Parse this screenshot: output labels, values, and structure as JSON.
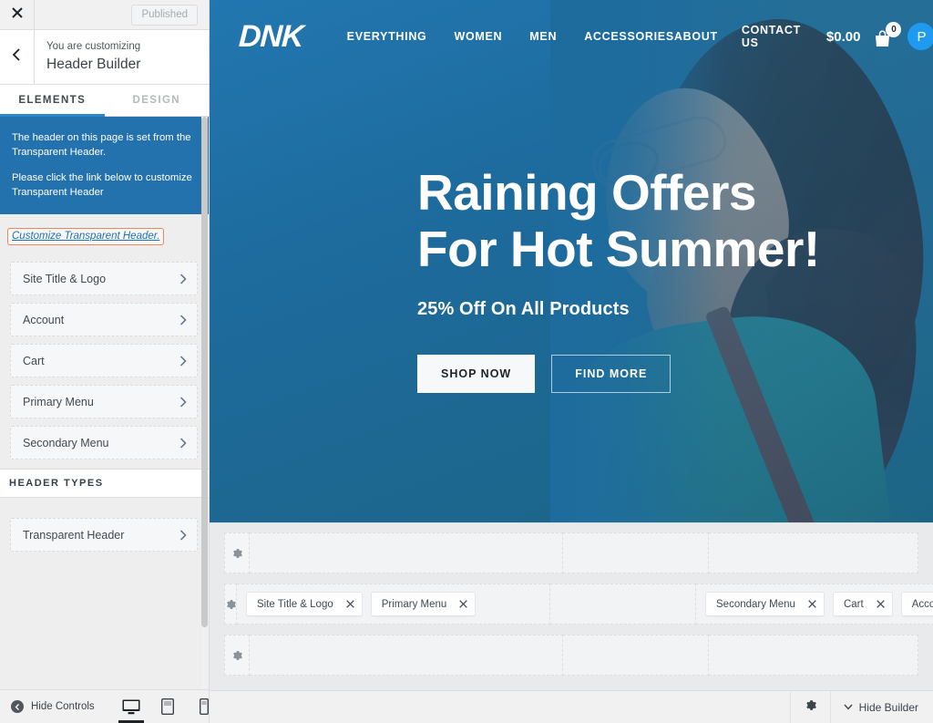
{
  "sidebar": {
    "close_icon": "close-icon",
    "published_label": "Published",
    "back_icon": "chevron-left-icon",
    "customizing_label": "You are customizing",
    "panel_title": "Header Builder",
    "tabs": [
      {
        "label": "ELEMENTS",
        "active": true
      },
      {
        "label": "DESIGN",
        "active": false
      }
    ],
    "notice": {
      "line1": "The header on this page is set from the Transparent Header.",
      "line2": "Please click the link below to customize Transparent Header"
    },
    "customize_link": "Customize Transparent Header.",
    "elements": [
      {
        "label": "Site Title & Logo"
      },
      {
        "label": "Account"
      },
      {
        "label": "Cart"
      },
      {
        "label": "Primary Menu"
      },
      {
        "label": "Secondary Menu"
      }
    ],
    "header_types_heading": "HEADER TYPES",
    "header_types": [
      {
        "label": "Transparent Header"
      }
    ],
    "footer": {
      "hide_controls_label": "Hide Controls",
      "devices": [
        {
          "name": "desktop",
          "active": true
        },
        {
          "name": "tablet",
          "active": false
        },
        {
          "name": "mobile",
          "active": false
        }
      ]
    }
  },
  "preview": {
    "header": {
      "logo": "DNK",
      "primary_menu": [
        {
          "label": "EVERYTHING"
        },
        {
          "label": "WOMEN"
        },
        {
          "label": "MEN"
        },
        {
          "label": "ACCESSORIES"
        }
      ],
      "secondary_menu": [
        {
          "label": "ABOUT"
        },
        {
          "label": "CONTACT US"
        }
      ],
      "cart_total": "$0.00",
      "cart_count": "0",
      "cart_icon": "shopping-bag-icon",
      "avatar_initial": "P"
    },
    "hero": {
      "title_line1": "Raining Offers",
      "title_line2": "For Hot Summer!",
      "subtitle": "25% Off On All Products",
      "button_primary": "SHOP NOW",
      "button_secondary": "FIND MORE"
    }
  },
  "builder": {
    "rows": [
      {
        "gear_icon": "gear-icon",
        "left": [],
        "center": [],
        "right": []
      },
      {
        "gear_icon": "gear-icon",
        "left": [
          {
            "label": "Site Title & Logo"
          },
          {
            "label": "Primary Menu"
          }
        ],
        "center": [],
        "right": [
          {
            "label": "Secondary Menu"
          },
          {
            "label": "Cart"
          },
          {
            "label": "Account"
          }
        ]
      },
      {
        "gear_icon": "gear-icon",
        "left": [],
        "center": [],
        "right": []
      }
    ],
    "bar": {
      "gear_icon": "gear-icon",
      "hide_builder_label": "Hide Builder",
      "chevron_icon": "chevron-down-icon"
    }
  },
  "colors": {
    "accent_blue": "#2b87cd",
    "notice_blue": "#2472ad",
    "link_highlight": "#f0845b",
    "hero_blue": "#1c6499",
    "hero_teal": "#1c6585",
    "avatar_blue": "#1e9bf0"
  }
}
